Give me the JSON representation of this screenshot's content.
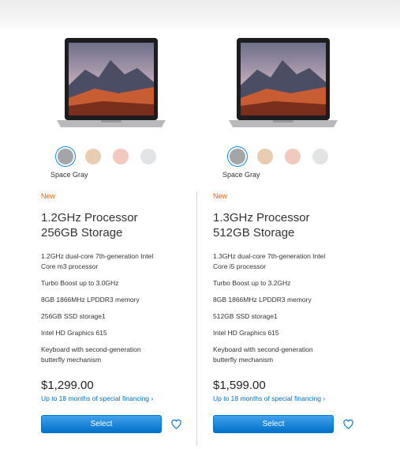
{
  "colors": {
    "accent": "#0070c9",
    "new_badge": "#f56300",
    "space_gray": "#a3a5a8",
    "gold": "#e8cdb0",
    "rose_gold": "#f2c9bd",
    "silver": "#e3e4e5"
  },
  "products": [
    {
      "selected_color": "Space Gray",
      "badge": "New",
      "title_line1": "1.2GHz Processor",
      "title_line2": "256GB Storage",
      "specs": [
        "1.2GHz dual-core 7th-generation Intel",
        "Core m3 processor",
        "Turbo Boost up to 3.0GHz",
        "8GB 1866MHz LPDDR3 memory",
        "256GB SSD storage1",
        "Intel HD Graphics 615",
        "Keyboard with second-generation",
        "butterfly mechanism"
      ],
      "price": "$1,299.00",
      "financing": "Up to 18 months of special financing ›",
      "select_label": "Select"
    },
    {
      "selected_color": "Space Gray",
      "badge": "New",
      "title_line1": "1.3GHz Processor",
      "title_line2": "512GB Storage",
      "specs": [
        "1.3GHz dual-core 7th-generation Intel",
        "Core i5 processor",
        "Turbo Boost up to 3.2GHz",
        "8GB 1866MHz LPDDR3 memory",
        "512GB SSD storage1",
        "Intel HD Graphics 615",
        "Keyboard with second-generation",
        "butterfly mechanism"
      ],
      "price": "$1,599.00",
      "financing": "Up to 18 months of special financing ›",
      "select_label": "Select"
    }
  ]
}
